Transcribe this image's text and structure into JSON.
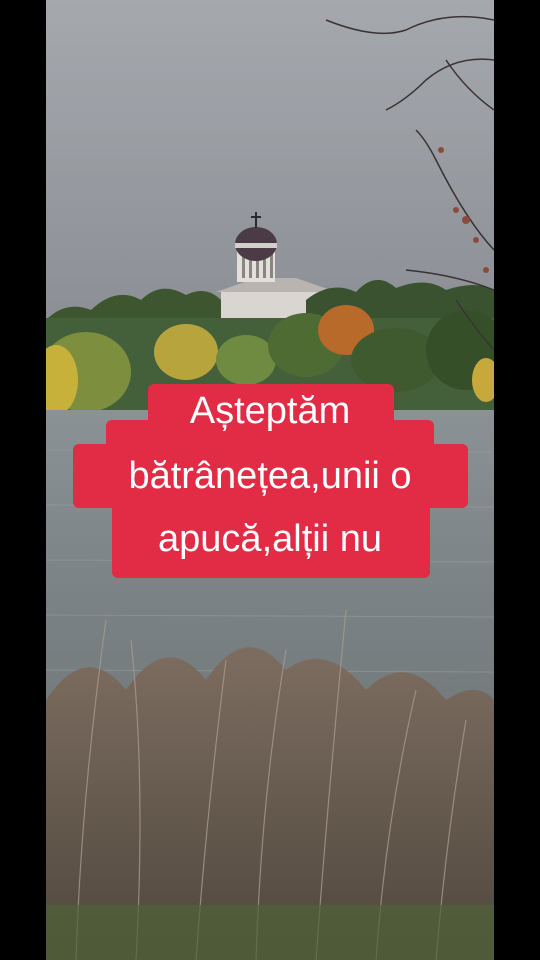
{
  "caption": {
    "line1": "Așteptăm",
    "line2": "bătrânețea,unii o",
    "line3": "apucă,alții nu",
    "background_color": "#e22b45",
    "text_color": "#ffffff"
  },
  "scene": {
    "sky_color": "#8e9298",
    "water_color": "#7b8386",
    "foliage_colors": [
      "#3f5a2e",
      "#c7b13b",
      "#b86a2a"
    ],
    "church_dome_color": "#4a3b44"
  }
}
